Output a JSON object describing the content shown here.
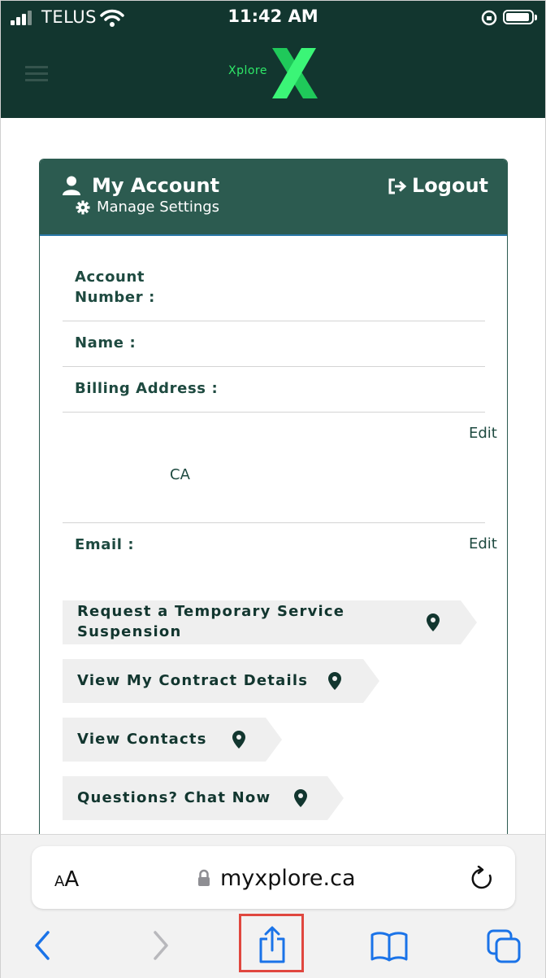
{
  "status_bar": {
    "carrier": "TELUS",
    "time": "11:42 AM"
  },
  "header": {
    "logo_text": "Xplore"
  },
  "account": {
    "title": "My Account",
    "manage_settings": "Manage Settings",
    "logout": "Logout",
    "account_number_label": "Account\nNumber :",
    "name_label": "Name :",
    "billing_address_label": "Billing Address :",
    "address_edit": "Edit",
    "address_country": "CA",
    "email_label": "Email :",
    "email_edit": "Edit"
  },
  "actions": [
    {
      "label": "Request a Temporary Service\nSuspension"
    },
    {
      "label": "View My Contract Details"
    },
    {
      "label": "View Contacts"
    },
    {
      "label": "Questions? Chat Now"
    }
  ],
  "browser": {
    "text_size_label_small": "A",
    "text_size_label_large": "A",
    "url": "myxplore.ca"
  },
  "colors": {
    "brand_dark": "#12362f",
    "card_header": "#2c5b50",
    "logo_green": "#2ee868",
    "highlight": "#e0473f"
  }
}
